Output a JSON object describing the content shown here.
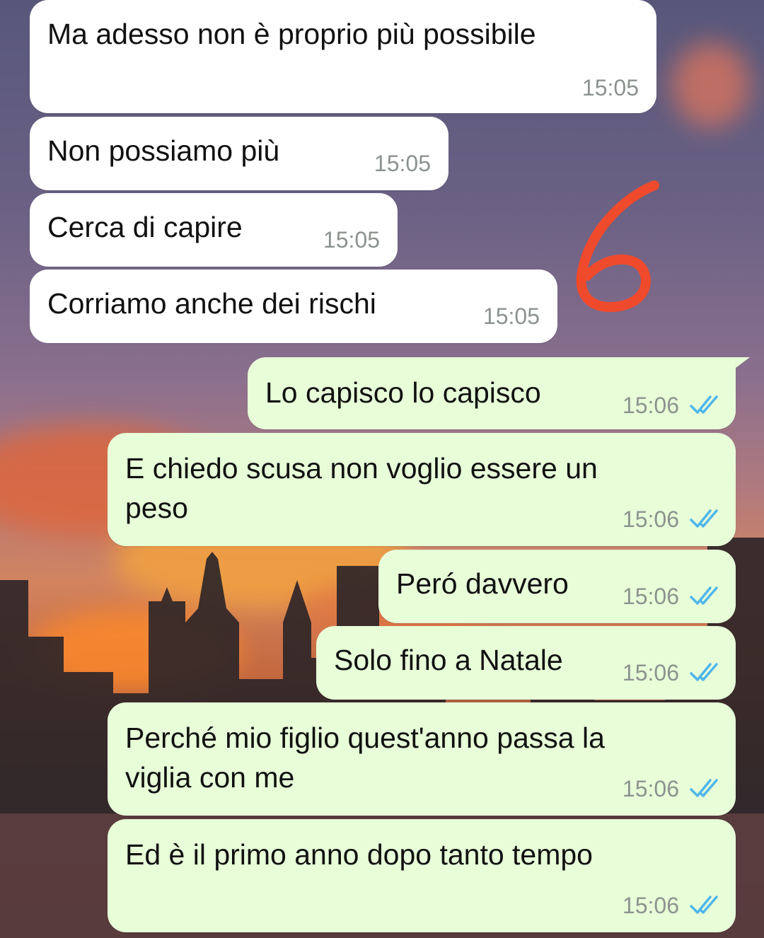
{
  "conversation": {
    "incoming": [
      {
        "text": "Ma adesso non è proprio più possibile",
        "time": "15:05"
      },
      {
        "text": "Non possiamo più",
        "time": "15:05"
      },
      {
        "text": "Cerca di capire",
        "time": "15:05"
      },
      {
        "text": "Corriamo anche dei rischi",
        "time": "15:05"
      }
    ],
    "outgoing": [
      {
        "text": "Lo capisco lo capisco",
        "time": "15:06"
      },
      {
        "text": "E chiedo scusa non voglio essere un\npeso",
        "time": "15:06"
      },
      {
        "text": "Peró davvero",
        "time": "15:06"
      },
      {
        "text": "Solo fino a Natale",
        "time": "15:06"
      },
      {
        "text": "Perché mio figlio quest'anno passa la\nviglia con me",
        "time": "15:06"
      },
      {
        "text": "Ed è il primo anno dopo tanto tempo",
        "time": "15:06"
      }
    ]
  },
  "icons": {
    "read_receipt": "double-check-icon",
    "annotation": "handwritten-number-annotation"
  },
  "colors": {
    "incoming_bubble": "#ffffff",
    "outgoing_bubble": "#e7fed8",
    "read_tick": "#4fb6ec",
    "annotation": "#f04a2c",
    "timestamp": "#8c938e"
  }
}
